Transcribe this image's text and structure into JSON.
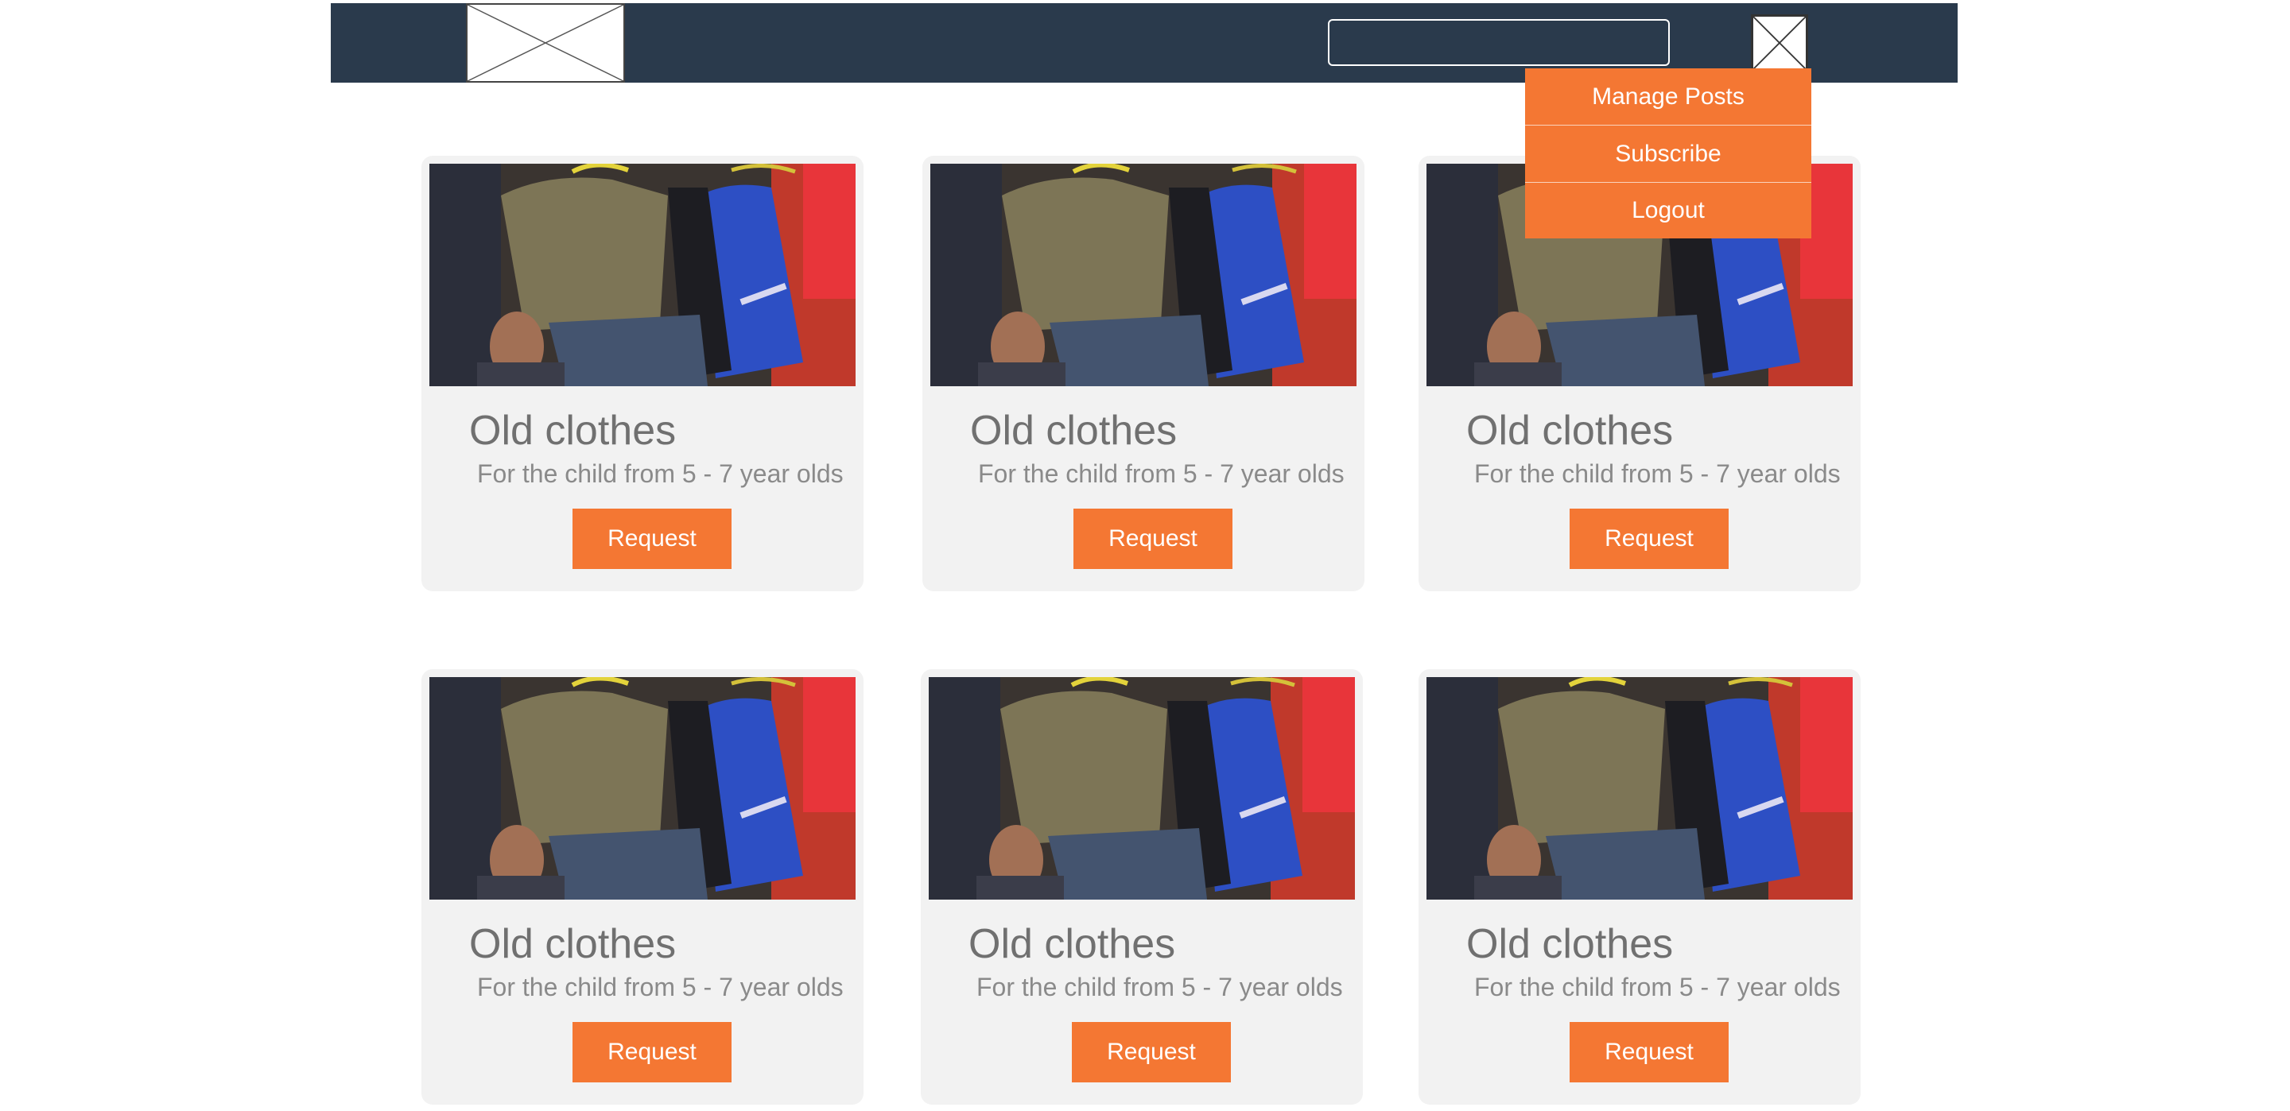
{
  "header": {
    "search_value": "",
    "search_placeholder": ""
  },
  "menu": {
    "items": [
      {
        "label": "Manage Posts"
      },
      {
        "label": "Subscribe"
      },
      {
        "label": "Logout"
      }
    ]
  },
  "posts": [
    {
      "title": "Old clothes",
      "description": "For the child from 5 - 7 year olds",
      "button": "Request"
    },
    {
      "title": "Old clothes",
      "description": "For the child from 5 - 7 year olds",
      "button": "Request"
    },
    {
      "title": "Old clothes",
      "description": "For the child from 5 - 7 year olds",
      "button": "Request"
    },
    {
      "title": "Old clothes",
      "description": "For the child from 5 - 7 year olds",
      "button": "Request"
    },
    {
      "title": "Old clothes",
      "description": "For the child from 5 - 7 year olds",
      "button": "Request"
    },
    {
      "title": "Old clothes",
      "description": "For the child from 5 - 7 year olds",
      "button": "Request"
    }
  ],
  "colors": {
    "header_bg": "#2a3a4c",
    "accent": "#f47733",
    "card_bg": "#f2f2f2"
  },
  "icons": {
    "logo": "placeholder-image-icon",
    "avatar": "placeholder-image-icon"
  }
}
